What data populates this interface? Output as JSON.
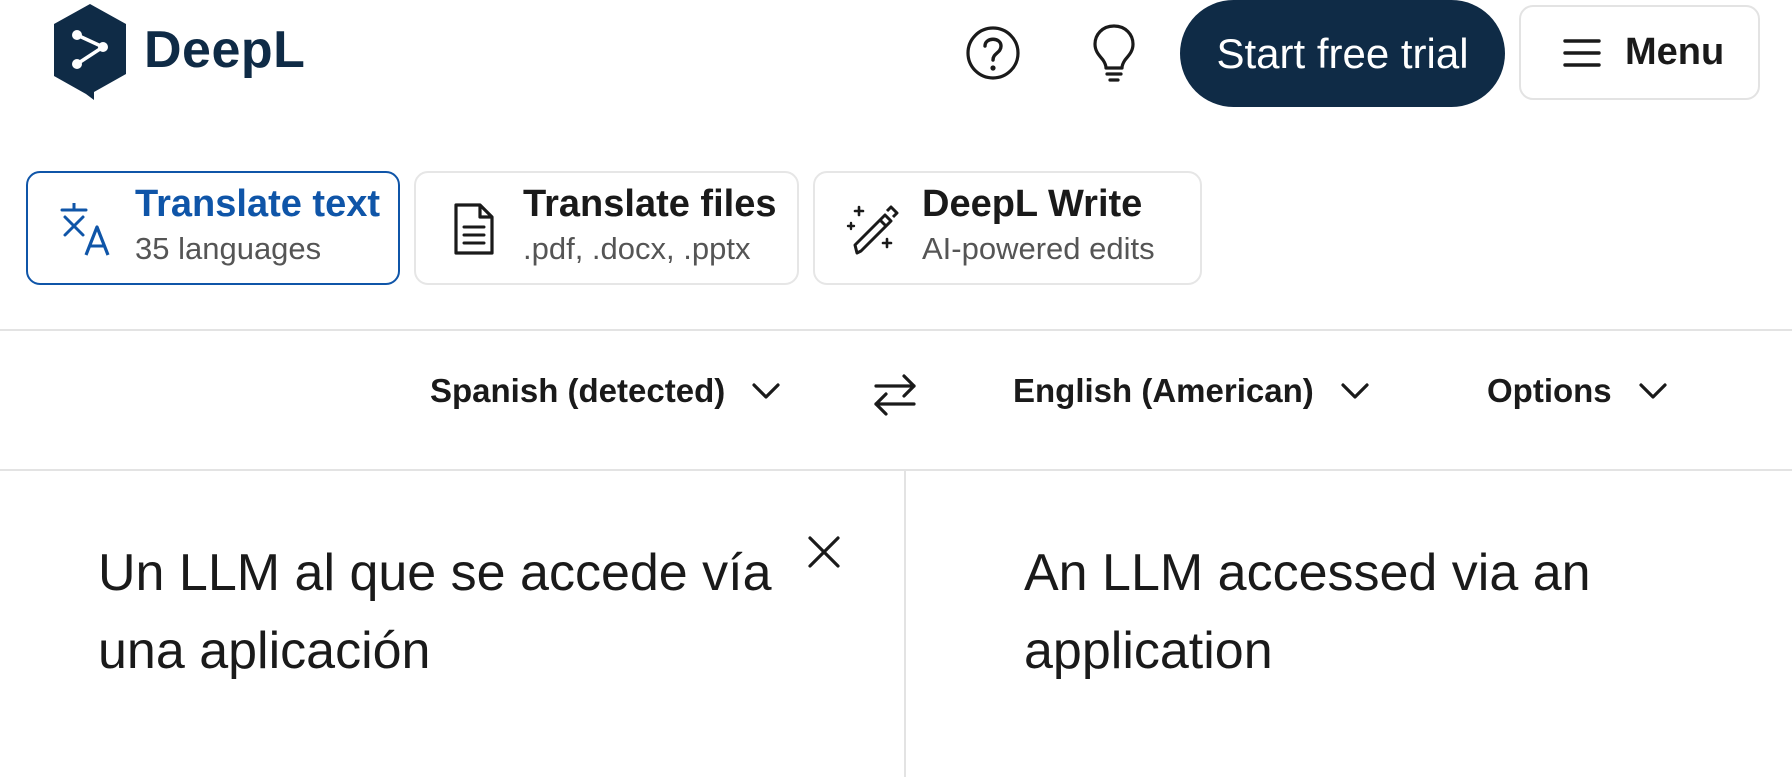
{
  "header": {
    "brand": "DeepL",
    "trial_button": "Start free trial",
    "menu_button": "Menu",
    "help_icon": "question-circle-icon",
    "idea_icon": "lightbulb-icon"
  },
  "tabs": [
    {
      "title": "Translate text",
      "subtitle": "35 languages",
      "icon": "translate-icon",
      "active": true
    },
    {
      "title": "Translate files",
      "subtitle": ".pdf, .docx, .pptx",
      "icon": "document-icon",
      "active": false
    },
    {
      "title": "DeepL Write",
      "subtitle": "AI-powered edits",
      "icon": "magic-pen-icon",
      "active": false
    }
  ],
  "language_bar": {
    "source_language": "Spanish (detected)",
    "target_language": "English (American)",
    "options": "Options"
  },
  "source": {
    "text": "Un LLM al que se accede vía una aplicación"
  },
  "target": {
    "text": "An LLM accessed via an application"
  },
  "colors": {
    "brand_navy": "#0f2b46",
    "accent_blue": "#0f55a8",
    "border": "#e3e3e3"
  }
}
